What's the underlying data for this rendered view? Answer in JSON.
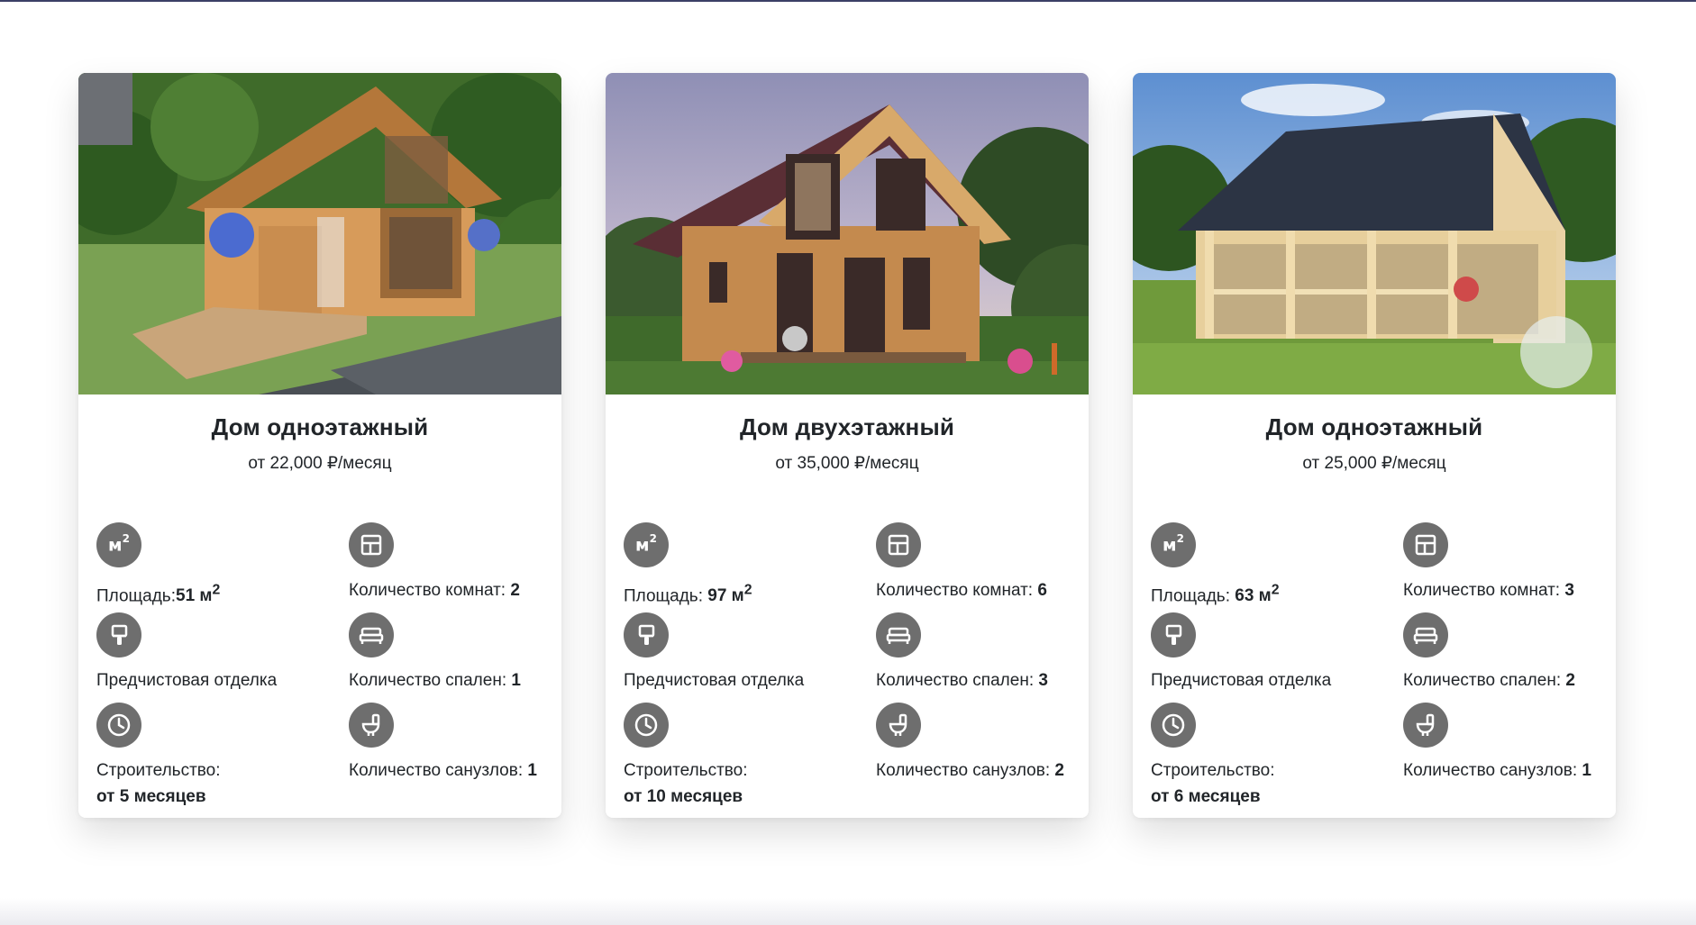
{
  "colors": {
    "icon_bg": "#6e6e6e",
    "text": "#212529",
    "card_bg": "#ffffff"
  },
  "cards": [
    {
      "title": "Дом одноэтажный",
      "price": "от 22,000 ₽/месяц",
      "area_label": "Площадь:",
      "area_value": "51 м",
      "area_sup": "2",
      "rooms_label": "Количество комнат: ",
      "rooms_value": "2",
      "finish_label": "Предчистовая отделка",
      "bedrooms_label": "Количество спален: ",
      "bedrooms_value": "1",
      "build_label": "Строительство:",
      "build_value": "от 5 месяцев",
      "bathrooms_label": "Количество санузлов: ",
      "bathrooms_value": "1"
    },
    {
      "title": "Дом двухэтажный",
      "price": "от 35,000 ₽/месяц",
      "area_label": "Площадь: ",
      "area_value": "97 м",
      "area_sup": "2",
      "rooms_label": "Количество комнат: ",
      "rooms_value": "6",
      "finish_label": "Предчистовая отделка",
      "bedrooms_label": "Количество спален: ",
      "bedrooms_value": "3",
      "build_label": "Строительство:",
      "build_value": "от 10 месяцев",
      "bathrooms_label": "Количество санузлов: ",
      "bathrooms_value": "2"
    },
    {
      "title": "Дом одноэтажный",
      "price": "от 25,000 ₽/месяц",
      "area_label": "Площадь: ",
      "area_value": "63 м",
      "area_sup": "2",
      "rooms_label": "Количество комнат: ",
      "rooms_value": "3",
      "finish_label": "Предчистовая отделка",
      "bedrooms_label": "Количество спален: ",
      "bedrooms_value": "2",
      "build_label": "Строительство:",
      "build_value": "от 6 месяцев",
      "bathrooms_label": "Количество санузлов: ",
      "bathrooms_value": "1"
    }
  ],
  "icons": {
    "area": "area-m2-icon",
    "rooms": "floor-plan-icon",
    "finish": "paint-brush-icon",
    "bedrooms": "bed-icon",
    "build": "clock-icon",
    "bathrooms": "toilet-icon"
  },
  "icon_text": {
    "area": "м",
    "area_sup": "2"
  }
}
